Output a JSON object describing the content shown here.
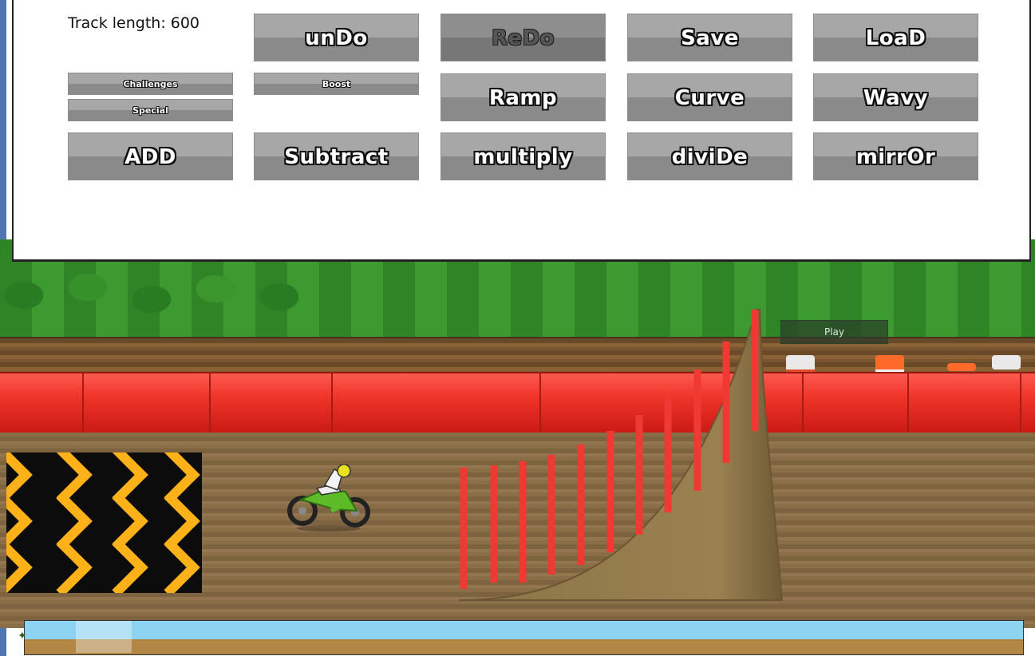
{
  "panel": {
    "track_length": "Track length: 600"
  },
  "toolbar": {
    "undo": "unDo",
    "redo": "ReDo",
    "save": "Save",
    "load": "LoaD",
    "challenges": "Challenges",
    "special": "Special",
    "boost": "Boost",
    "ramp": "Ramp",
    "curve": "Curve",
    "wavy": "Wavy",
    "add": "ADD",
    "subtract": "Subtract",
    "multiply": "multiply",
    "divide": "diviDe",
    "mirror": "mirrOr"
  },
  "game": {
    "play": "Play"
  },
  "colors": {
    "button_gray": "#9a9a9a",
    "barrier_red": "#ef3328",
    "dirt_brown": "#8a6e48",
    "ramp_stripe": "#ee3a32",
    "chevron_orange": "#ffb11a",
    "sky_blue": "#8fd3f3"
  }
}
